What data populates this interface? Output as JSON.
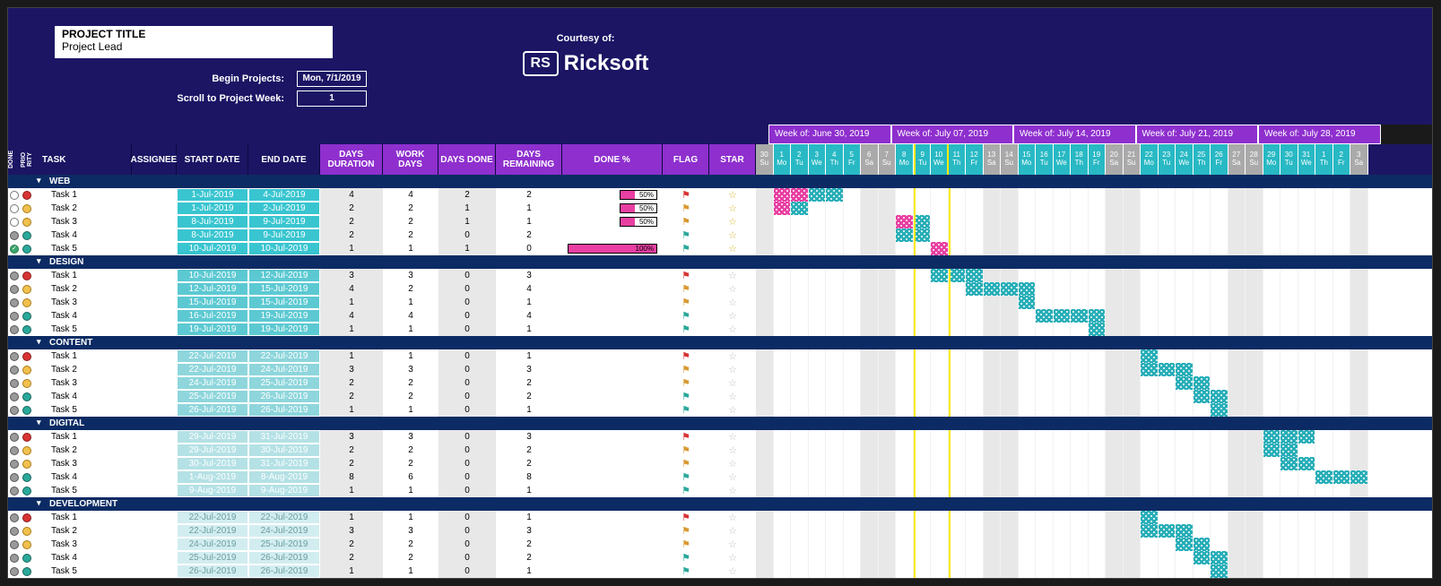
{
  "header": {
    "title": "PROJECT TITLE",
    "lead": "Project Lead",
    "begin_label": "Begin Projects:",
    "begin_value": "Mon, 7/1/2019",
    "scroll_label": "Scroll to Project Week:",
    "scroll_value": "1",
    "courtesy": "Courtesy of:",
    "brand_badge": "RS",
    "brand_name": "Ricksoft"
  },
  "cols": {
    "done": "DONE",
    "prio": "PRIO RITY",
    "task": "TASK",
    "assignee": "ASSIGNEE",
    "start": "START DATE",
    "end": "END DATE",
    "dur": "DAYS DURATION",
    "work": "WORK DAYS",
    "ddone": "DAYS DONE",
    "dremain": "DAYS REMAINING",
    "pct": "DONE %",
    "flag": "FLAG",
    "star": "STAR"
  },
  "weeks": [
    {
      "label": "Week of: June 30, 2019"
    },
    {
      "label": "Week of: July 07, 2019"
    },
    {
      "label": "Week of: July 14, 2019"
    },
    {
      "label": "Week of: July 21, 2019"
    },
    {
      "label": "Week of: July 28, 2019"
    }
  ],
  "days": [
    {
      "n": "30",
      "d": "Su",
      "we": true
    },
    {
      "n": "1",
      "d": "Mo"
    },
    {
      "n": "2",
      "d": "Tu"
    },
    {
      "n": "3",
      "d": "We"
    },
    {
      "n": "4",
      "d": "Th"
    },
    {
      "n": "5",
      "d": "Fr"
    },
    {
      "n": "6",
      "d": "Sa",
      "we": true
    },
    {
      "n": "7",
      "d": "Su",
      "we": true
    },
    {
      "n": "8",
      "d": "Mo"
    },
    {
      "n": "9",
      "d": "Tu",
      "today1": true
    },
    {
      "n": "10",
      "d": "We",
      "today2": true
    },
    {
      "n": "11",
      "d": "Th"
    },
    {
      "n": "12",
      "d": "Fr"
    },
    {
      "n": "13",
      "d": "Sa",
      "we": true
    },
    {
      "n": "14",
      "d": "Su",
      "we": true
    },
    {
      "n": "15",
      "d": "Mo"
    },
    {
      "n": "16",
      "d": "Tu"
    },
    {
      "n": "17",
      "d": "We"
    },
    {
      "n": "18",
      "d": "Th"
    },
    {
      "n": "19",
      "d": "Fr"
    },
    {
      "n": "20",
      "d": "Sa",
      "we": true
    },
    {
      "n": "21",
      "d": "Su",
      "we": true
    },
    {
      "n": "22",
      "d": "Mo"
    },
    {
      "n": "23",
      "d": "Tu"
    },
    {
      "n": "24",
      "d": "We"
    },
    {
      "n": "25",
      "d": "Th"
    },
    {
      "n": "26",
      "d": "Fr"
    },
    {
      "n": "27",
      "d": "Sa",
      "we": true
    },
    {
      "n": "28",
      "d": "Su",
      "we": true
    },
    {
      "n": "29",
      "d": "Mo"
    },
    {
      "n": "30",
      "d": "Tu"
    },
    {
      "n": "31",
      "d": "We"
    },
    {
      "n": "1",
      "d": "Th"
    },
    {
      "n": "2",
      "d": "Fr"
    },
    {
      "n": "3",
      "d": "Sa",
      "we": true
    }
  ],
  "today_col_a": 9,
  "today_col_b": 11,
  "sections": [
    {
      "name": "WEB",
      "shade": 0,
      "tasks": [
        {
          "done": "open",
          "prio": "red",
          "task": "Task 1",
          "start": "1-Jul-2019",
          "end": "4-Jul-2019",
          "dur": 4,
          "work": 4,
          "ddone": 2,
          "drem": 2,
          "pct": "50%",
          "pctW": 40,
          "flag": "red",
          "star": "gold",
          "barStart": 1,
          "barLen": 4,
          "pinkStart": 1,
          "pinkLen": 2
        },
        {
          "done": "open",
          "prio": "orange",
          "task": "Task 2",
          "start": "1-Jul-2019",
          "end": "2-Jul-2019",
          "dur": 2,
          "work": 2,
          "ddone": 1,
          "drem": 1,
          "pct": "50%",
          "pctW": 40,
          "flag": "orange",
          "star": "gold",
          "barStart": 1,
          "barLen": 2,
          "pinkStart": 1,
          "pinkLen": 1
        },
        {
          "done": "open",
          "prio": "orange",
          "task": "Task 3",
          "start": "8-Jul-2019",
          "end": "9-Jul-2019",
          "dur": 2,
          "work": 2,
          "ddone": 1,
          "drem": 1,
          "pct": "50%",
          "pctW": 40,
          "flag": "orange",
          "star": "gold",
          "barStart": 8,
          "barLen": 2,
          "pinkStart": 8,
          "pinkLen": 1
        },
        {
          "done": "grey",
          "prio": "teal",
          "task": "Task 4",
          "start": "8-Jul-2019",
          "end": "9-Jul-2019",
          "dur": 2,
          "work": 2,
          "ddone": 0,
          "drem": 2,
          "flag": "teal",
          "star": "gold",
          "barStart": 8,
          "barLen": 2
        },
        {
          "done": "check",
          "prio": "teal",
          "task": "Task 5",
          "start": "10-Jul-2019",
          "end": "10-Jul-2019",
          "dur": 1,
          "work": 1,
          "ddone": 1,
          "drem": 0,
          "pct": "100%",
          "pctW": 100,
          "flag": "teal",
          "star": "gold",
          "barStart": 10,
          "barLen": 1,
          "pinkStart": 10,
          "pinkLen": 1
        }
      ]
    },
    {
      "name": "DESIGN",
      "shade": 1,
      "tasks": [
        {
          "done": "grey",
          "prio": "red",
          "task": "Task 1",
          "start": "10-Jul-2019",
          "end": "12-Jul-2019",
          "dur": 3,
          "work": 3,
          "ddone": 0,
          "drem": 3,
          "flag": "red",
          "star": "grey",
          "barStart": 10,
          "barLen": 3
        },
        {
          "done": "grey",
          "prio": "orange",
          "task": "Task 2",
          "start": "12-Jul-2019",
          "end": "15-Jul-2019",
          "dur": 4,
          "work": 2,
          "ddone": 0,
          "drem": 4,
          "flag": "orange",
          "star": "grey",
          "barStart": 12,
          "barLen": 4
        },
        {
          "done": "grey",
          "prio": "orange",
          "task": "Task 3",
          "start": "15-Jul-2019",
          "end": "15-Jul-2019",
          "dur": 1,
          "work": 1,
          "ddone": 0,
          "drem": 1,
          "flag": "orange",
          "star": "grey",
          "barStart": 15,
          "barLen": 1
        },
        {
          "done": "grey",
          "prio": "teal",
          "task": "Task 4",
          "start": "16-Jul-2019",
          "end": "19-Jul-2019",
          "dur": 4,
          "work": 4,
          "ddone": 0,
          "drem": 4,
          "flag": "teal",
          "star": "grey",
          "barStart": 16,
          "barLen": 4
        },
        {
          "done": "grey",
          "prio": "teal",
          "task": "Task 5",
          "start": "19-Jul-2019",
          "end": "19-Jul-2019",
          "dur": 1,
          "work": 1,
          "ddone": 0,
          "drem": 1,
          "flag": "teal",
          "star": "grey",
          "barStart": 19,
          "barLen": 1
        }
      ]
    },
    {
      "name": "CONTENT",
      "shade": 2,
      "tasks": [
        {
          "done": "grey",
          "prio": "red",
          "task": "Task 1",
          "start": "22-Jul-2019",
          "end": "22-Jul-2019",
          "dur": 1,
          "work": 1,
          "ddone": 0,
          "drem": 1,
          "flag": "red",
          "star": "grey",
          "barStart": 22,
          "barLen": 1
        },
        {
          "done": "grey",
          "prio": "orange",
          "task": "Task 2",
          "start": "22-Jul-2019",
          "end": "24-Jul-2019",
          "dur": 3,
          "work": 3,
          "ddone": 0,
          "drem": 3,
          "flag": "orange",
          "star": "grey",
          "barStart": 22,
          "barLen": 3
        },
        {
          "done": "grey",
          "prio": "orange",
          "task": "Task 3",
          "start": "24-Jul-2019",
          "end": "25-Jul-2019",
          "dur": 2,
          "work": 2,
          "ddone": 0,
          "drem": 2,
          "flag": "orange",
          "star": "grey",
          "barStart": 24,
          "barLen": 2
        },
        {
          "done": "grey",
          "prio": "teal",
          "task": "Task 4",
          "start": "25-Jul-2019",
          "end": "26-Jul-2019",
          "dur": 2,
          "work": 2,
          "ddone": 0,
          "drem": 2,
          "flag": "teal",
          "star": "grey",
          "barStart": 25,
          "barLen": 2
        },
        {
          "done": "grey",
          "prio": "teal",
          "task": "Task 5",
          "start": "26-Jul-2019",
          "end": "26-Jul-2019",
          "dur": 1,
          "work": 1,
          "ddone": 0,
          "drem": 1,
          "flag": "teal",
          "star": "grey",
          "barStart": 26,
          "barLen": 1
        }
      ]
    },
    {
      "name": "DIGITAL",
      "shade": 3,
      "tasks": [
        {
          "done": "grey",
          "prio": "red",
          "task": "Task 1",
          "start": "29-Jul-2019",
          "end": "31-Jul-2019",
          "dur": 3,
          "work": 3,
          "ddone": 0,
          "drem": 3,
          "flag": "red",
          "star": "grey",
          "barStart": 29,
          "barLen": 3
        },
        {
          "done": "grey",
          "prio": "orange",
          "task": "Task 2",
          "start": "29-Jul-2019",
          "end": "30-Jul-2019",
          "dur": 2,
          "work": 2,
          "ddone": 0,
          "drem": 2,
          "flag": "orange",
          "star": "grey",
          "barStart": 29,
          "barLen": 2
        },
        {
          "done": "grey",
          "prio": "orange",
          "task": "Task 3",
          "start": "30-Jul-2019",
          "end": "31-Jul-2019",
          "dur": 2,
          "work": 2,
          "ddone": 0,
          "drem": 2,
          "flag": "orange",
          "star": "grey",
          "barStart": 30,
          "barLen": 2
        },
        {
          "done": "grey",
          "prio": "teal",
          "task": "Task 4",
          "start": "1-Aug-2019",
          "end": "8-Aug-2019",
          "dur": 8,
          "work": 6,
          "ddone": 0,
          "drem": 8,
          "flag": "teal",
          "star": "grey",
          "barStart": 32,
          "barLen": 3
        },
        {
          "done": "grey",
          "prio": "teal",
          "task": "Task 5",
          "start": "9-Aug-2019",
          "end": "9-Aug-2019",
          "dur": 1,
          "work": 1,
          "ddone": 0,
          "drem": 1,
          "flag": "teal",
          "star": "grey"
        }
      ]
    },
    {
      "name": "DEVELOPMENT",
      "shade": 4,
      "tasks": [
        {
          "done": "grey",
          "prio": "red",
          "task": "Task 1",
          "start": "22-Jul-2019",
          "end": "22-Jul-2019",
          "dur": 1,
          "work": 1,
          "ddone": 0,
          "drem": 1,
          "flag": "red",
          "star": "grey",
          "barStart": 22,
          "barLen": 1
        },
        {
          "done": "grey",
          "prio": "orange",
          "task": "Task 2",
          "start": "22-Jul-2019",
          "end": "24-Jul-2019",
          "dur": 3,
          "work": 3,
          "ddone": 0,
          "drem": 3,
          "flag": "orange",
          "star": "grey",
          "barStart": 22,
          "barLen": 3
        },
        {
          "done": "grey",
          "prio": "orange",
          "task": "Task 3",
          "start": "24-Jul-2019",
          "end": "25-Jul-2019",
          "dur": 2,
          "work": 2,
          "ddone": 0,
          "drem": 2,
          "flag": "orange",
          "star": "grey",
          "barStart": 24,
          "barLen": 2
        },
        {
          "done": "grey",
          "prio": "teal",
          "task": "Task 4",
          "start": "25-Jul-2019",
          "end": "26-Jul-2019",
          "dur": 2,
          "work": 2,
          "ddone": 0,
          "drem": 2,
          "flag": "teal",
          "star": "grey",
          "barStart": 25,
          "barLen": 2
        },
        {
          "done": "grey",
          "prio": "teal",
          "task": "Task 5",
          "start": "26-Jul-2019",
          "end": "26-Jul-2019",
          "dur": 1,
          "work": 1,
          "ddone": 0,
          "drem": 1,
          "flag": "teal",
          "star": "grey",
          "barStart": 26,
          "barLen": 1
        }
      ]
    }
  ]
}
